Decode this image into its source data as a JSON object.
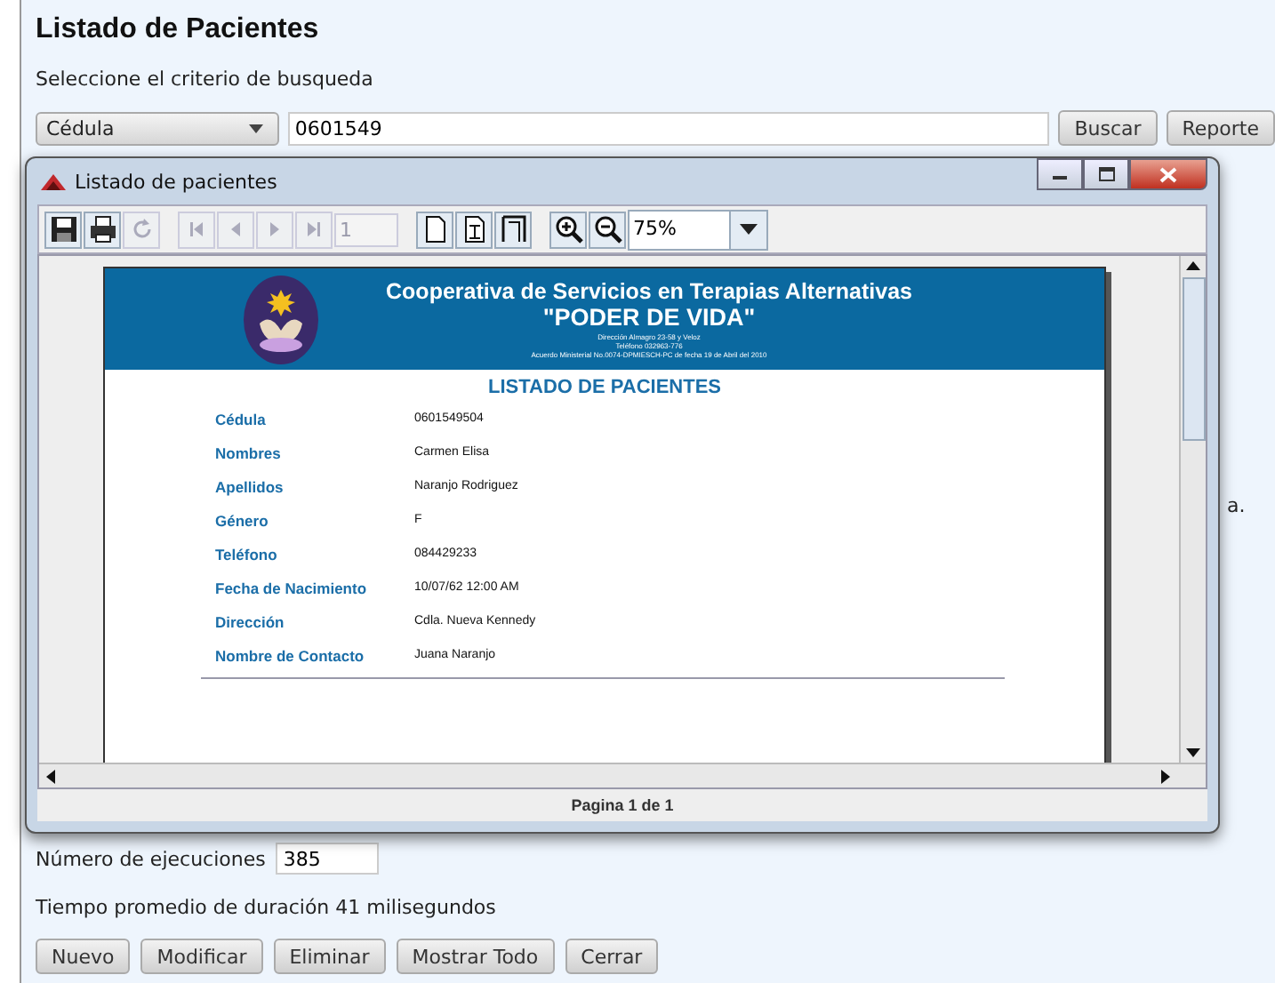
{
  "title": "Listado de Pacientes",
  "criteria_label": "Seleccione el criterio de busqueda",
  "criteria_dropdown": {
    "value": "Cédula"
  },
  "search_field": {
    "value": "0601549"
  },
  "search_buttons": [
    "Buscar",
    "Reporte"
  ],
  "background_fragment": "a.",
  "dialog": {
    "title": "Listado de pacientes",
    "toolbar": [
      {
        "kind": "save",
        "disabled": false
      },
      {
        "kind": "print",
        "disabled": false
      },
      {
        "kind": "reload",
        "disabled": true
      },
      {
        "kind": "first",
        "disabled": true
      },
      {
        "kind": "prev",
        "disabled": true
      },
      {
        "kind": "next",
        "disabled": true
      },
      {
        "kind": "last",
        "disabled": true
      },
      {
        "kind": "page",
        "disabled": true,
        "value": "1"
      },
      {
        "kind": "actual",
        "disabled": false
      },
      {
        "kind": "fitpage",
        "disabled": false
      },
      {
        "kind": "fitwidth",
        "disabled": false
      },
      {
        "kind": "zoomin",
        "disabled": false
      },
      {
        "kind": "zoomout",
        "disabled": false
      },
      {
        "kind": "zoom",
        "disabled": false,
        "value": "75%"
      }
    ],
    "report": {
      "org": "Cooperativa de Servicios en Terapias Alternativas",
      "name": "\"PODER DE VIDA\"",
      "info": [
        "Dirección Almagro 23-58 y Veloz",
        "Teléfono 032963-776",
        "Acuerdo Ministerial No.0074-DPMIESCH-PC de fecha 19 de Abril del 2010"
      ],
      "heading": "LISTADO DE PACIENTES",
      "fields": [
        {
          "label": "Cédula",
          "value": "0601549504"
        },
        {
          "label": "Nombres",
          "value": "Carmen Elisa"
        },
        {
          "label": "Apellidos",
          "value": "Naranjo Rodriguez"
        },
        {
          "label": "Género",
          "value": "F"
        },
        {
          "label": "Teléfono",
          "value": "084429233"
        },
        {
          "label": "Fecha de Nacimiento",
          "value": "10/07/62 12:00 AM"
        },
        {
          "label": "Dirección",
          "value": "Cdla. Nueva Kennedy"
        },
        {
          "label": "Nombre de Contacto",
          "value": "Juana Naranjo"
        }
      ]
    },
    "status": "Pagina 1 de 1"
  },
  "executions": {
    "label": "Número de ejecuciones",
    "value": "385"
  },
  "duration": "Tiempo promedio de duración  41 milisegundos",
  "buttons": [
    "Nuevo",
    "Modificar",
    "Eliminar",
    "Mostrar Todo",
    "Cerrar"
  ]
}
